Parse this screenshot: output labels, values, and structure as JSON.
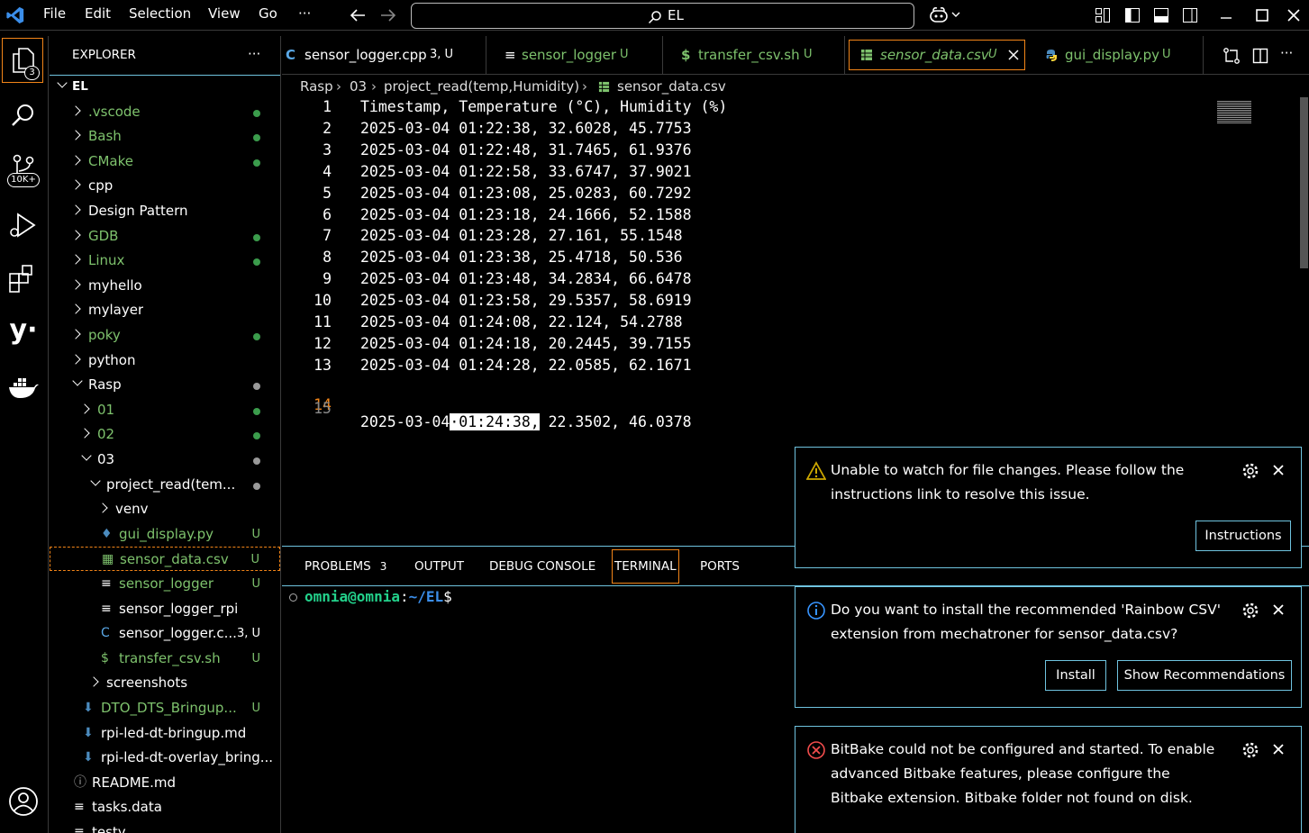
{
  "titlebar": {
    "menu": [
      "File",
      "Edit",
      "Selection",
      "View",
      "Go",
      "···"
    ],
    "search_text": "EL"
  },
  "activity": {
    "explorer_badge": "3",
    "scm_badge": "10K+"
  },
  "explorer": {
    "header": "EXPLORER",
    "more": "···",
    "root": "EL",
    "items": [
      {
        "label": ".vscode",
        "deco": "dot"
      },
      {
        "label": "Bash",
        "deco": "dot"
      },
      {
        "label": "CMake",
        "deco": "dot"
      },
      {
        "label": "cpp",
        "deco": ""
      },
      {
        "label": "Design Pattern",
        "deco": ""
      },
      {
        "label": "GDB",
        "deco": "dot"
      },
      {
        "label": "Linux",
        "deco": "dot"
      },
      {
        "label": "myhello",
        "deco": ""
      },
      {
        "label": "mylayer",
        "deco": ""
      },
      {
        "label": "poky",
        "deco": "dot"
      },
      {
        "label": "python",
        "deco": ""
      },
      {
        "label": "Rasp",
        "deco": "dot-gray"
      },
      {
        "label": "01",
        "deco": "dot"
      },
      {
        "label": "02",
        "deco": "dot"
      },
      {
        "label": "03",
        "deco": "dot-gray"
      },
      {
        "label": "project_read(tem...",
        "deco": "dot-gray"
      },
      {
        "label": "venv",
        "deco": ""
      },
      {
        "label": "gui_display.py",
        "deco": "U"
      },
      {
        "label": "sensor_data.csv",
        "deco": "U"
      },
      {
        "label": "sensor_logger",
        "deco": "U"
      },
      {
        "label": "sensor_logger_rpi",
        "deco": ""
      },
      {
        "label": "sensor_logger.c...",
        "deco": "3, U"
      },
      {
        "label": "transfer_csv.sh",
        "deco": "U"
      },
      {
        "label": "screenshots",
        "deco": ""
      },
      {
        "label": "DTO_DTS_Bringup...",
        "deco": "U"
      },
      {
        "label": "rpi-led-dt-bringup.md",
        "deco": ""
      },
      {
        "label": "rpi-led-dt-overlay_bring...",
        "deco": ""
      },
      {
        "label": "README.md",
        "deco": ""
      },
      {
        "label": "tasks.data",
        "deco": ""
      },
      {
        "label": "testy",
        "deco": ""
      }
    ]
  },
  "tabs": [
    {
      "label": "sensor_logger.cpp",
      "deco": "3, U"
    },
    {
      "label": "sensor_logger",
      "deco": "U"
    },
    {
      "label": "transfer_csv.sh",
      "deco": "U"
    },
    {
      "label": "sensor_data.csv",
      "deco": "U"
    },
    {
      "label": "gui_display.py",
      "deco": "U"
    }
  ],
  "breadcrumb": [
    "Rasp",
    "03",
    "project_read(temp,Humidity)",
    "sensor_data.csv"
  ],
  "editor": {
    "lines": [
      "Timestamp, Temperature (°C), Humidity (%)",
      "2025-03-04 01:22:38, 32.6028, 45.7753",
      "2025-03-04 01:22:48, 31.7465, 61.9376",
      "2025-03-04 01:22:58, 33.6747, 37.9021",
      "2025-03-04 01:23:08, 25.0283, 60.7292",
      "2025-03-04 01:23:18, 24.1666, 52.1588",
      "2025-03-04 01:23:28, 27.161, 55.1548",
      "2025-03-04 01:23:38, 25.4718, 50.536",
      "2025-03-04 01:23:48, 34.2834, 66.6478",
      "2025-03-04 01:23:58, 29.5357, 58.6919",
      "2025-03-04 01:24:08, 22.124, 54.2788",
      "2025-03-04 01:24:18, 20.2445, 39.7155",
      "2025-03-04 01:24:28, 22.0585, 62.1671",
      "2025-03-04 01:24:38, 22.3502, 46.0378",
      ""
    ],
    "line14_pre": "2025-03-04",
    "line14_sel": "·01:24:38,",
    "line14_post": " 22.3502, 46.0378",
    "current_line": 14
  },
  "panel": {
    "tabs": [
      "PROBLEMS",
      "OUTPUT",
      "DEBUG CONSOLE",
      "TERMINAL",
      "PORTS"
    ],
    "problems_count": "3",
    "terminal": {
      "user": "omnia@omnia",
      "sep": ":",
      "path": "~/EL",
      "prompt": "$"
    }
  },
  "notifications": [
    {
      "type": "warning",
      "message": "Unable to watch for file changes. Please follow the instructions link to resolve this issue.",
      "buttons": [
        "Instructions"
      ]
    },
    {
      "type": "info",
      "message": "Do you want to install the recommended 'Rainbow CSV' extension from mechatroner for sensor_data.csv?",
      "buttons": [
        "Install",
        "Show Recommendations"
      ]
    },
    {
      "type": "error",
      "message": "BitBake could not be configured and started. To enable advanced Bitbake features, please configure the Bitbake extension. Bitbake folder not found on disk.",
      "buttons": []
    }
  ],
  "colors": {
    "accent": "#f38518",
    "border": "#6fc3df",
    "untracked": "#7ec26d",
    "vscode_blue": "#3b8eea"
  }
}
